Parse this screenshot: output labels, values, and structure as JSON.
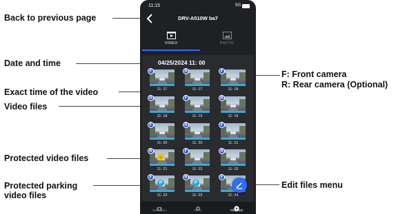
{
  "annotations": {
    "back": "Back to previous page",
    "datetime": "Date and time",
    "exact_time": "Exact time of the video",
    "video_files": "Video files",
    "protected": "Protected video files",
    "protected_parking_1": "Protected parking",
    "protected_parking_2": "video files",
    "front_camera": "F:  Front camera",
    "rear_camera": "R:  Rear camera (Optional)",
    "edit_menu": "Edit files menu"
  },
  "status": {
    "time": "11:15",
    "network": "5G"
  },
  "header": {
    "title": "DRV-A510W ba7"
  },
  "tabs": [
    {
      "label": "VIDEO",
      "icon": "video-icon",
      "active": true
    },
    {
      "label": "PHOTO",
      "icon": "photo-icon",
      "active": false
    }
  ],
  "date_group": "04/25/2024 11: 00",
  "videos": [
    {
      "cam": "F",
      "time": "11: 17",
      "extra": ""
    },
    {
      "cam": "R",
      "time": "11: 17",
      "extra": ""
    },
    {
      "cam": "F",
      "time": "11: 18",
      "extra": ""
    },
    {
      "cam": "R",
      "time": "11: 18",
      "extra": ""
    },
    {
      "cam": "F",
      "time": "11: 19",
      "extra": ""
    },
    {
      "cam": "R",
      "time": "11: 19",
      "extra": ""
    },
    {
      "cam": "F",
      "time": "11: 20",
      "extra": ""
    },
    {
      "cam": "R",
      "time": "11: 20",
      "extra": ""
    },
    {
      "cam": "F",
      "time": "11: 21",
      "extra": ""
    },
    {
      "cam": "R",
      "time": "11: 21",
      "extra": "lock"
    },
    {
      "cam": "F",
      "time": "11: 22",
      "extra": ""
    },
    {
      "cam": "R",
      "time": "11: 22",
      "extra": ""
    },
    {
      "cam": "F",
      "time": "11: 23",
      "extra": "parking"
    },
    {
      "cam": "R",
      "time": "11: 23",
      "extra": "parking"
    },
    {
      "cam": "F",
      "time": "11: 24",
      "extra": ""
    }
  ],
  "badge_symbols": {
    "lock": "🔒",
    "parking": "P"
  },
  "nav": [
    {
      "label": "Dash Cam",
      "icon": "dashcam-icon",
      "active": false
    },
    {
      "label": "Menu",
      "icon": "gear-icon",
      "active": false
    },
    {
      "label": "Playback",
      "icon": "playback-icon",
      "active": true
    }
  ],
  "colors": {
    "accent": "#2f6df6",
    "background": "#1f2023",
    "protected": "#f0c419",
    "parking": "#25a8e0"
  }
}
